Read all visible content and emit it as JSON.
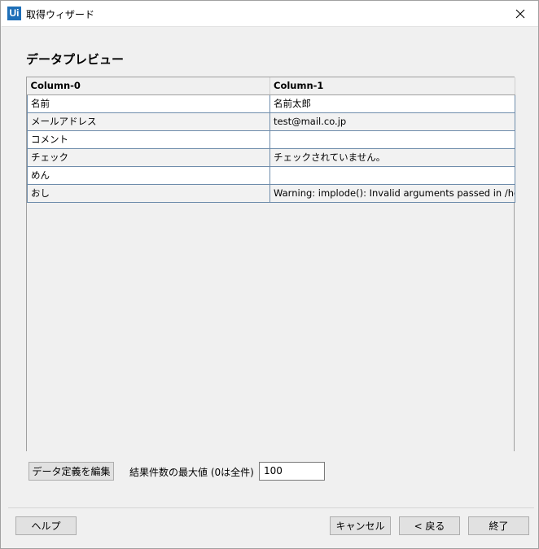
{
  "window": {
    "title": "取得ウィザード",
    "logo_text": "Ui"
  },
  "heading": "データプレビュー",
  "grid": {
    "columns": [
      "Column-0",
      "Column-1"
    ],
    "rows": [
      [
        "名前",
        "名前太郎"
      ],
      [
        "メールアドレス",
        "test@mail.co.jp"
      ],
      [
        "コメント",
        ""
      ],
      [
        "チェック",
        "チェックされていません。"
      ],
      [
        "めん",
        ""
      ],
      [
        "おし",
        "Warning: implode(): Invalid arguments passed in /home"
      ]
    ]
  },
  "edit_button": "データ定義を編集",
  "max_results": {
    "label": "結果件数の最大値 (0は全件)",
    "value": "100"
  },
  "footer": {
    "help": "ヘルプ",
    "cancel": "キャンセル",
    "back": "< 戻る",
    "finish": "終了"
  },
  "colors": {
    "logo": "#1e6fb8",
    "grid_border": "#6e8cab"
  },
  "icons": {
    "close": "close-icon"
  }
}
